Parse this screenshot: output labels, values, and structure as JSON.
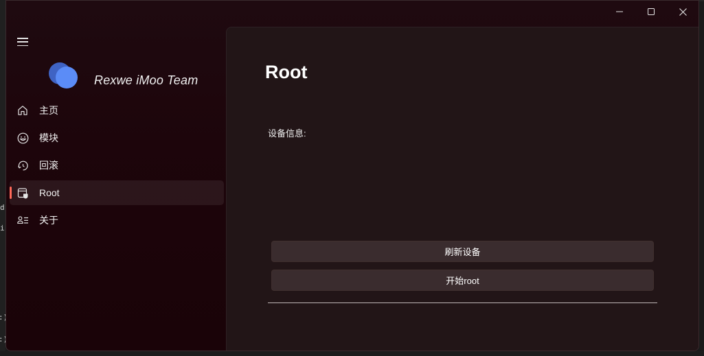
{
  "window": {
    "caption_icons": [
      "minimize-icon",
      "maximize-icon",
      "close-icon"
    ]
  },
  "nav": {
    "brand": "Rexwe iMoo Team",
    "items": [
      {
        "label": "主页",
        "icon": "home-icon"
      },
      {
        "label": "模块",
        "icon": "emoji-icon"
      },
      {
        "label": "回滚",
        "icon": "rollback-icon"
      },
      {
        "label": "Root",
        "icon": "root-icon",
        "selected": true
      },
      {
        "label": "关于",
        "icon": "contact-info-icon"
      }
    ]
  },
  "main": {
    "title": "Root",
    "device_info_label": "设备信息:",
    "refresh_button": "刷新设备",
    "start_root_button": "开始root"
  },
  "background": {
    "fragments": [
      "d",
      "i",
      ":)",
      ":)"
    ]
  },
  "colors": {
    "accent": "#ff6a5a",
    "logo_primary": "#5b8cf7",
    "logo_secondary": "#3f63c4"
  }
}
